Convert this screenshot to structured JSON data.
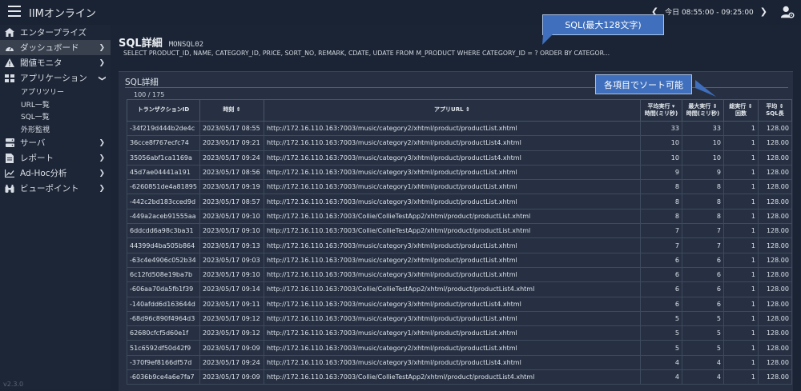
{
  "header": {
    "app_title": "IIMオンライン",
    "time_range": "今日 08:55:00 - 09:25:00",
    "prev_icon": "chevron-left-icon",
    "next_icon": "chevron-right-icon",
    "user_icon": "user-settings-icon"
  },
  "sidebar": {
    "items": [
      {
        "label": "エンタープライズ",
        "icon": "home-icon"
      },
      {
        "label": "ダッシュボード",
        "icon": "dashboard-icon"
      },
      {
        "label": "閾値モニタ",
        "icon": "warning-icon"
      },
      {
        "label": "アプリケーション",
        "icon": "grid-icon"
      },
      {
        "label": "サーバ",
        "icon": "server-icon"
      },
      {
        "label": "レポート",
        "icon": "file-icon"
      },
      {
        "label": "Ad-Hoc分析",
        "icon": "line-chart-icon"
      },
      {
        "label": "ビューポイント",
        "icon": "binoculars-icon"
      }
    ],
    "sub_items": [
      "アプリツリー",
      "URL一覧",
      "SQL一覧",
      "外形監視"
    ],
    "version": "v2.3.0"
  },
  "sql": {
    "title": "SQL詳細",
    "code": "MONSQL02",
    "statement": "SELECT PRODUCT_ID, NAME, CATEGORY_ID, PRICE, SORT_NO, REMARK, CDATE, UDATE FROM M_PRODUCT WHERE CATEGORY_ID = ? ORDER BY CATEGOR..."
  },
  "panel": {
    "title": "SQL詳細",
    "count": "100 / 175"
  },
  "callouts": {
    "sql_note": "SQL(最大128文字)",
    "sort_note": "各項目でソート可能"
  },
  "table": {
    "headers": {
      "tx": "トランザクションID",
      "time": "時刻",
      "url": "アプリURL",
      "avg1": "平均実行",
      "avg2": "時間(ミリ秒)",
      "max1": "最大実行",
      "max2": "時間(ミリ秒)",
      "cnt1": "総実行",
      "cnt2": "回数",
      "len1": "平均",
      "len2": "SQL長"
    },
    "rows": [
      [
        "-34f219d444b2de4c",
        "2023/05/17 08:55",
        "http://172.16.110.163:7003/music/category2/xhtml/product/productList.xhtml",
        "33",
        "33",
        "1",
        "128.00"
      ],
      [
        "36cce8f767ecfc74",
        "2023/05/17 09:21",
        "http://172.16.110.163:7003/music/category2/xhtml/product/productList4.xhtml",
        "10",
        "10",
        "1",
        "128.00"
      ],
      [
        "35056abf1ca1169a",
        "2023/05/17 09:24",
        "http://172.16.110.163:7003/music/category3/xhtml/product/productList4.xhtml",
        "10",
        "10",
        "1",
        "128.00"
      ],
      [
        "45d7ae04441a191",
        "2023/05/17 08:56",
        "http://172.16.110.163:7003/music/category3/xhtml/product/productList.xhtml",
        "9",
        "9",
        "1",
        "128.00"
      ],
      [
        "-6260851de4a81895",
        "2023/05/17 09:19",
        "http://172.16.110.163:7003/music/category1/xhtml/product/productList.xhtml",
        "8",
        "8",
        "1",
        "128.00"
      ],
      [
        "-442c2bd183cced9d",
        "2023/05/17 08:57",
        "http://172.16.110.163:7003/music/category3/xhtml/product/productList.xhtml",
        "8",
        "8",
        "1",
        "128.00"
      ],
      [
        "-449a2aceb91555aa",
        "2023/05/17 09:10",
        "http://172.16.110.163:7003/Collie/CollieTestApp2/xhtml/product/productList.xhtml",
        "8",
        "8",
        "1",
        "128.00"
      ],
      [
        "6ddcdd6a98c3ba31",
        "2023/05/17 09:10",
        "http://172.16.110.163:7003/Collie/CollieTestApp2/xhtml/product/productList.xhtml",
        "7",
        "7",
        "1",
        "128.00"
      ],
      [
        "44399d4ba505b864",
        "2023/05/17 09:13",
        "http://172.16.110.163:7003/music/category3/xhtml/product/productList.xhtml",
        "7",
        "7",
        "1",
        "128.00"
      ],
      [
        "-63c4e4906c052b34",
        "2023/05/17 09:03",
        "http://172.16.110.163:7003/music/category2/xhtml/product/productList.xhtml",
        "6",
        "6",
        "1",
        "128.00"
      ],
      [
        "6c12fd508e19ba7b",
        "2023/05/17 09:10",
        "http://172.16.110.163:7003/music/category3/xhtml/product/productList.xhtml",
        "6",
        "6",
        "1",
        "128.00"
      ],
      [
        "-606aa70da5fb1f39",
        "2023/05/17 09:14",
        "http://172.16.110.163:7003/Collie/CollieTestApp2/xhtml/product/productList4.xhtml",
        "6",
        "6",
        "1",
        "128.00"
      ],
      [
        "-140afdd6d163644d",
        "2023/05/17 09:11",
        "http://172.16.110.163:7003/music/category3/xhtml/product/productList4.xhtml",
        "6",
        "6",
        "1",
        "128.00"
      ],
      [
        "-68d96c890f4964d3",
        "2023/05/17 09:12",
        "http://172.16.110.163:7003/music/category3/xhtml/product/productList.xhtml",
        "5",
        "5",
        "1",
        "128.00"
      ],
      [
        "62680cfcf5d60e1f",
        "2023/05/17 09:12",
        "http://172.16.110.163:7003/music/category1/xhtml/product/productList.xhtml",
        "5",
        "5",
        "1",
        "128.00"
      ],
      [
        "51c6592df50d42f9",
        "2023/05/17 09:09",
        "http://172.16.110.163:7003/music/category2/xhtml/product/productList.xhtml",
        "5",
        "5",
        "1",
        "128.00"
      ],
      [
        "-370f9ef8166df57d",
        "2023/05/17 09:24",
        "http://172.16.110.163:7003/music/category3/xhtml/product/productList4.xhtml",
        "4",
        "4",
        "1",
        "128.00"
      ],
      [
        "-6036b9ce4a6e7fa7",
        "2023/05/17 09:09",
        "http://172.16.110.163:7003/Collie/CollieTestApp2/xhtml/product/productList4.xhtml",
        "4",
        "4",
        "1",
        "128.00"
      ]
    ]
  },
  "colors": {
    "background": "#1b2434",
    "sidebar": "#1d2636",
    "callout": "#3f6fbd",
    "panel": "#263042"
  }
}
